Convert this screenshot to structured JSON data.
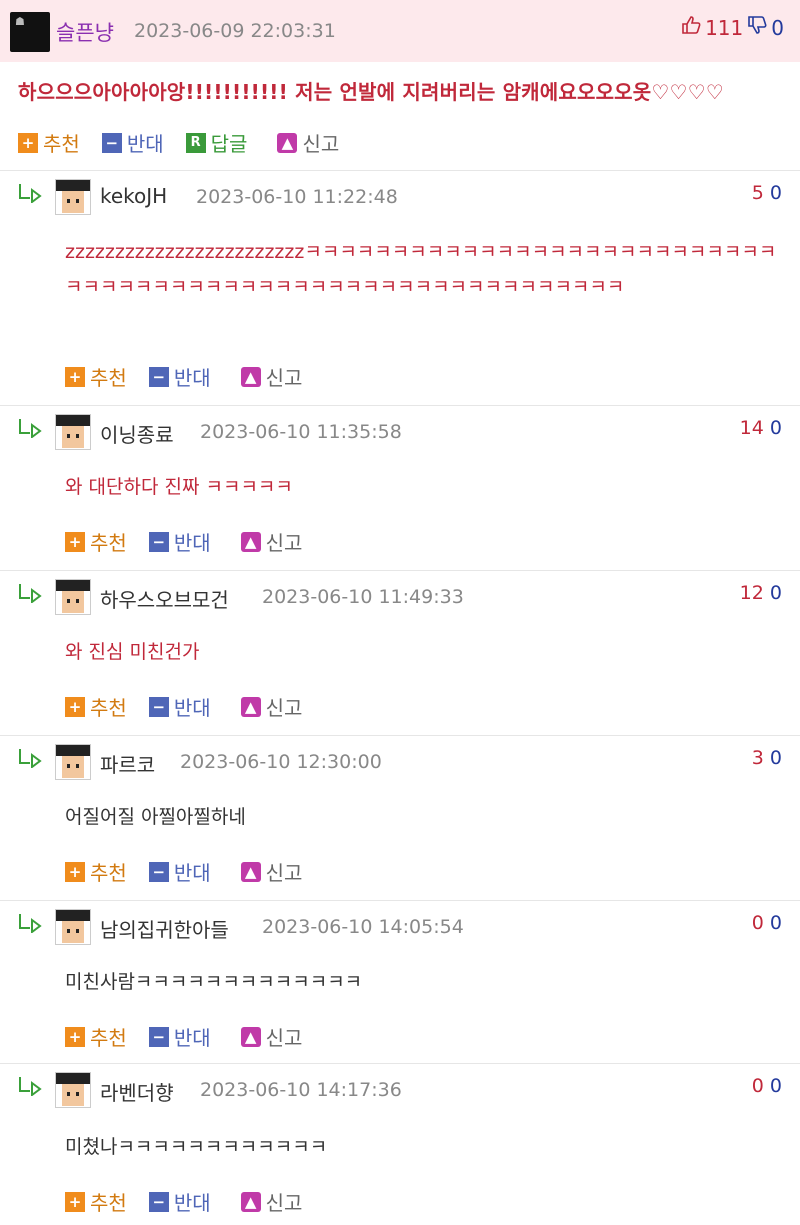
{
  "post": {
    "author": "슬픈냥",
    "date": "2023-06-09 22:03:31",
    "up": "111",
    "down": "0",
    "title": "하으으으아아아아앙!!!!!!!!!!! 저는 언발에 지려버리는 암캐에요오오오옷♡♡♡♡",
    "actions": {
      "recommend": "추천",
      "oppose": "반대",
      "reply": "답글",
      "report": "신고"
    }
  },
  "comments": [
    {
      "author": "kekoJH",
      "date": "2023-06-10 11:22:48",
      "up": "5",
      "down": "0",
      "text": "zzzzzzzzzzzzzzzzzzzzzzzzㅋㅋㅋㅋㅋㅋㅋㅋㅋㅋㅋㅋㅋㅋㅋㅋㅋㅋㅋㅋㅋㅋㅋㅋㅋㅋㅋㅋㅋㅋㅋㅋㅋㅋㅋㅋㅋㅋㅋㅋㅋㅋㅋㅋㅋㅋㅋㅋㅋㅋㅋㅋㅋㅋㅋㅋㅋㅋㅋ"
    },
    {
      "author": "이닝종료",
      "date": "2023-06-10 11:35:58",
      "up": "14",
      "down": "0",
      "text": "와 대단하다 진짜 ㅋㅋㅋㅋㅋ"
    },
    {
      "author": "하우스오브모건",
      "date": "2023-06-10 11:49:33",
      "up": "12",
      "down": "0",
      "text": "와 진심 미친건가"
    },
    {
      "author": "파르코",
      "date": "2023-06-10 12:30:00",
      "up": "3",
      "down": "0",
      "text": "어질어질 아찔아찔하네"
    },
    {
      "author": "남의집귀한아들",
      "date": "2023-06-10 14:05:54",
      "up": "0",
      "down": "0",
      "text": "미친사람ㅋㅋㅋㅋㅋㅋㅋㅋㅋㅋㅋㅋㅋ"
    },
    {
      "author": "라벤더향",
      "date": "2023-06-10 14:17:36",
      "up": "0",
      "down": "0",
      "text": "미쳤나ㅋㅋㅋㅋㅋㅋㅋㅋㅋㅋㅋㅋ"
    }
  ],
  "comment_actions": {
    "recommend": "추천",
    "oppose": "반대",
    "report": "신고"
  },
  "colors": {
    "up": "#c0283a",
    "down": "#233a9c",
    "author": "#8a2fb0",
    "header_bg": "#fde9ec"
  },
  "icons": {
    "up": "thumbs-up-icon",
    "down": "thumbs-down-icon",
    "reply_arrow": "reply-arrow-icon"
  }
}
